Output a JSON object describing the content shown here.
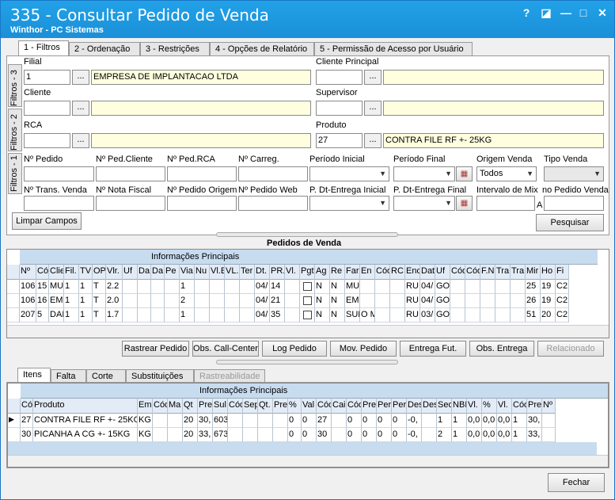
{
  "window": {
    "title": "335 - Consultar Pedido de Venda",
    "subtitle": "Winthor - PC Sistemas",
    "help": "?",
    "restore": "◪",
    "minimize": "—",
    "maximize": "□",
    "close": "✕"
  },
  "tabs": [
    {
      "label": "1 - Filtros"
    },
    {
      "label": "2 - Ordenação"
    },
    {
      "label": "3 - Restrições"
    },
    {
      "label": "4 - Opções de Relatório"
    },
    {
      "label": "5 - Permissão de Acesso por Usuário"
    }
  ],
  "vtabs": [
    "Filtros - 1",
    "Filtros - 2",
    "Filtros - 3"
  ],
  "filters": {
    "filial_label": "Filial",
    "filial_code": "1",
    "filial_name": "EMPRESA DE IMPLANTACAO LTDA",
    "cliente_principal_label": "Cliente Principal",
    "cliente_label": "Cliente",
    "supervisor_label": "Supervisor",
    "rca_label": "RCA",
    "produto_label": "Produto",
    "produto_code": "27",
    "produto_name": "CONTRA FILE RF +- 25KG",
    "dots": "...",
    "row1": [
      "Nº Pedido",
      "Nº Ped.Cliente",
      "Nº Ped.RCA",
      "Nº Carreg.",
      "Período Inicial",
      "Período Final",
      "Origem Venda",
      "Tipo Venda"
    ],
    "row2": [
      "Nº Trans. Venda",
      "Nº Nota Fiscal",
      "Nº Pedido Origem",
      "Nº Pedido Web",
      "P. Dt-Entrega Inicial",
      "P. Dt-Entrega Final",
      "Intervalo de Mix",
      "no Pedido Venda"
    ],
    "origem_value": "Todos",
    "mix_sep": "A",
    "limpar": "Limpar Campos",
    "pesquisar": "Pesquisar"
  },
  "pedidos": {
    "title": "Pedidos de  Venda",
    "group": "Informações Principais",
    "cols": [
      "Nº",
      "Cód",
      "Clie",
      "Fil.",
      "TV",
      "OP",
      "Vlr.",
      "Uf",
      "Da",
      "Da",
      "Pe",
      "Via",
      "Nu",
      "Vl.E",
      "VL.",
      "Ter",
      "Dt.",
      "PR.",
      "Vl.",
      "Pgt",
      "Ag",
      "Re",
      "Far",
      "En",
      "Cód",
      "RC",
      "Enc",
      "Dat",
      "Uf",
      "Cód",
      "Cód",
      "F.N",
      "Tra",
      "Tra",
      "Mir",
      "Ho",
      "Fi"
    ],
    "rows": [
      [
        "106",
        "15",
        "MU",
        "1",
        "1",
        "T",
        "2.2",
        "",
        "",
        "",
        "",
        "1",
        "",
        "",
        "",
        "",
        "04/",
        "14",
        "",
        "☐",
        "N",
        "N",
        "MU",
        "",
        "",
        "",
        "RU",
        "04/",
        "GO",
        "",
        "",
        "",
        "",
        "",
        "25",
        "19",
        "C2"
      ],
      [
        "106",
        "16",
        "EMI",
        "1",
        "1",
        "T",
        "2.0",
        "",
        "",
        "",
        "",
        "2",
        "",
        "",
        "",
        "",
        "04/",
        "21",
        "",
        "☐",
        "N",
        "N",
        "EMI",
        "",
        "",
        "",
        "RU",
        "04/",
        "GO",
        "",
        "",
        "",
        "",
        "",
        "26",
        "19",
        "C2"
      ],
      [
        "207",
        "5",
        "DAI",
        "1",
        "1",
        "T",
        "1.7",
        "",
        "",
        "",
        "",
        "1",
        "",
        "",
        "",
        "",
        "04/",
        "35",
        "",
        "☐",
        "N",
        "N",
        "SUF",
        "O M",
        "",
        "",
        "RU",
        "03/",
        "GO",
        "",
        "",
        "",
        "",
        "",
        "51",
        "20",
        "C2"
      ]
    ]
  },
  "actions": [
    "Rastrear Pedido",
    "Obs. Call-Center",
    "Log Pedido",
    "Mov. Pedido",
    "Entrega Fut.",
    "Obs. Entrega",
    "Relacionado"
  ],
  "subtabs": [
    "Itens",
    "Falta",
    "Corte",
    "Substituições",
    "Rastreabilidade"
  ],
  "itens": {
    "group": "Informações Principais",
    "cols": [
      "Cód",
      "Produto",
      "Em",
      "Cód",
      "Ma",
      "Qt",
      "Pre",
      "Sul",
      "Cód",
      "Sep",
      "Qt.",
      "Pre",
      "%",
      "Val",
      "Cód",
      "Cai",
      "Cód",
      "Pre",
      "Per",
      "Per",
      "Des",
      "Des",
      "Seq",
      "NBI",
      "Vl.",
      "%",
      "Vl.",
      "Cód",
      "Pre",
      "Nº"
    ],
    "rows": [
      [
        "27",
        "CONTRA FILE RF +- 25KG",
        "KG",
        "",
        "",
        "20",
        "30,",
        "603",
        "",
        "",
        "",
        "",
        "0",
        "0",
        "27",
        "",
        "0",
        "0",
        "0",
        "0",
        "-0,",
        "",
        "1",
        "1",
        "0,0",
        "0,0",
        "0,0",
        "1",
        "30,",
        ""
      ],
      [
        "30",
        "PICANHA A CG +- 15KG",
        "KG",
        "",
        "",
        "20",
        "33,",
        "673",
        "",
        "",
        "",
        "",
        "0",
        "0",
        "30",
        "",
        "0",
        "0",
        "0",
        "0",
        "-0,",
        "",
        "2",
        "1",
        "0,0",
        "0,0",
        "0,0",
        "1",
        "33,",
        ""
      ]
    ]
  },
  "fechar": "Fechar"
}
